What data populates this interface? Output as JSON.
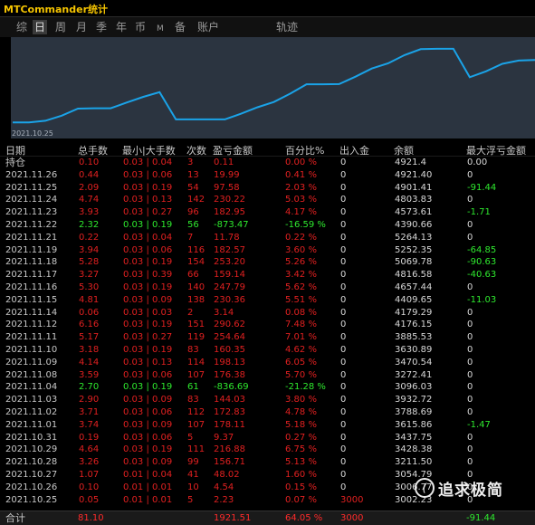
{
  "window": {
    "title": "MTCommander统计"
  },
  "tabs": [
    {
      "label": "综",
      "active": false
    },
    {
      "label": "日",
      "active": true
    },
    {
      "label": "周",
      "active": false
    },
    {
      "label": "月",
      "active": false
    },
    {
      "label": "季",
      "active": false
    },
    {
      "label": "年",
      "active": false
    },
    {
      "label": "币",
      "active": false
    },
    {
      "label": "M",
      "active": false
    },
    {
      "label": "备",
      "active": false
    },
    {
      "label": "账户",
      "active": false
    },
    {
      "label": "轨迹",
      "active": false
    }
  ],
  "chart": {
    "date_label": "2021.10.25",
    "line_color": "#1aa3e8",
    "background": "#2b3440"
  },
  "chart_data": {
    "type": "line",
    "x": [
      "2021.10.25",
      "2021.10.26",
      "2021.10.27",
      "2021.10.28",
      "2021.10.29",
      "2021.10.30",
      "2021.10.31",
      "2021.11.01",
      "2021.11.02",
      "2021.11.03",
      "2021.11.04",
      "2021.11.05",
      "2021.11.06",
      "2021.11.07",
      "2021.11.08",
      "2021.11.09",
      "2021.11.10",
      "2021.11.11",
      "2021.11.12",
      "2021.11.13",
      "2021.11.14",
      "2021.11.15",
      "2021.11.16",
      "2021.11.17",
      "2021.11.18",
      "2021.11.19",
      "2021.11.20",
      "2021.11.21",
      "2021.11.22",
      "2021.11.23",
      "2021.11.24",
      "2021.11.25",
      "2021.11.26"
    ],
    "values": [
      3002.23,
      3006.77,
      3054.79,
      3211.5,
      3428.38,
      3437.75,
      3437.75,
      3615.86,
      3788.69,
      3932.72,
      3096.03,
      3096.03,
      3096.03,
      3096.03,
      3272.41,
      3470.54,
      3630.89,
      3885.53,
      4176.15,
      4176.15,
      4179.29,
      4409.65,
      4657.44,
      4816.58,
      5069.78,
      5252.35,
      5264.13,
      5264.13,
      4390.66,
      4573.61,
      4803.83,
      4901.41,
      4921.4
    ],
    "ylim": [
      2900,
      5400
    ]
  },
  "table": {
    "headers": [
      "日期",
      "总手数",
      "最小|大手数",
      "次数",
      "盈亏金额",
      "百分比%",
      "出入金",
      "余额",
      "最大浮亏金额"
    ],
    "rows": [
      {
        "date": "持仓",
        "lots": "0.10",
        "range": "0.03 | 0.04",
        "count": "3",
        "pnl": "0.11",
        "pct": "0.00 %",
        "io": "0",
        "bal": "4921.4",
        "dd": "0.00",
        "color": "red",
        "ddcolor": "white"
      },
      {
        "date": "2021.11.26",
        "lots": "0.44",
        "range": "0.03 | 0.06",
        "count": "13",
        "pnl": "19.99",
        "pct": "0.41 %",
        "io": "0",
        "bal": "4921.40",
        "dd": "0",
        "color": "red",
        "ddcolor": "white"
      },
      {
        "date": "2021.11.25",
        "lots": "2.09",
        "range": "0.03 | 0.19",
        "count": "54",
        "pnl": "97.58",
        "pct": "2.03 %",
        "io": "0",
        "bal": "4901.41",
        "dd": "-91.44",
        "color": "red",
        "ddcolor": "green"
      },
      {
        "date": "2021.11.24",
        "lots": "4.74",
        "range": "0.03 | 0.13",
        "count": "142",
        "pnl": "230.22",
        "pct": "5.03 %",
        "io": "0",
        "bal": "4803.83",
        "dd": "0",
        "color": "red",
        "ddcolor": "white"
      },
      {
        "date": "2021.11.23",
        "lots": "3.93",
        "range": "0.03 | 0.27",
        "count": "96",
        "pnl": "182.95",
        "pct": "4.17 %",
        "io": "0",
        "bal": "4573.61",
        "dd": "-1.71",
        "color": "red",
        "ddcolor": "green"
      },
      {
        "date": "2021.11.22",
        "lots": "2.32",
        "range": "0.03 | 0.19",
        "count": "56",
        "pnl": "-873.47",
        "pct": "-16.59 %",
        "io": "0",
        "bal": "4390.66",
        "dd": "0",
        "color": "green",
        "ddcolor": "white"
      },
      {
        "date": "2021.11.21",
        "lots": "0.22",
        "range": "0.03 | 0.04",
        "count": "7",
        "pnl": "11.78",
        "pct": "0.22 %",
        "io": "0",
        "bal": "5264.13",
        "dd": "0",
        "color": "red",
        "ddcolor": "white"
      },
      {
        "date": "2021.11.19",
        "lots": "3.94",
        "range": "0.03 | 0.06",
        "count": "116",
        "pnl": "182.57",
        "pct": "3.60 %",
        "io": "0",
        "bal": "5252.35",
        "dd": "-64.85",
        "color": "red",
        "ddcolor": "green"
      },
      {
        "date": "2021.11.18",
        "lots": "5.28",
        "range": "0.03 | 0.19",
        "count": "154",
        "pnl": "253.20",
        "pct": "5.26 %",
        "io": "0",
        "bal": "5069.78",
        "dd": "-90.63",
        "color": "red",
        "ddcolor": "green"
      },
      {
        "date": "2021.11.17",
        "lots": "3.27",
        "range": "0.03 | 0.39",
        "count": "66",
        "pnl": "159.14",
        "pct": "3.42 %",
        "io": "0",
        "bal": "4816.58",
        "dd": "-40.63",
        "color": "red",
        "ddcolor": "green"
      },
      {
        "date": "2021.11.16",
        "lots": "5.30",
        "range": "0.03 | 0.19",
        "count": "140",
        "pnl": "247.79",
        "pct": "5.62 %",
        "io": "0",
        "bal": "4657.44",
        "dd": "0",
        "color": "red",
        "ddcolor": "white"
      },
      {
        "date": "2021.11.15",
        "lots": "4.81",
        "range": "0.03 | 0.09",
        "count": "138",
        "pnl": "230.36",
        "pct": "5.51 %",
        "io": "0",
        "bal": "4409.65",
        "dd": "-11.03",
        "color": "red",
        "ddcolor": "green"
      },
      {
        "date": "2021.11.14",
        "lots": "0.06",
        "range": "0.03 | 0.03",
        "count": "2",
        "pnl": "3.14",
        "pct": "0.08 %",
        "io": "0",
        "bal": "4179.29",
        "dd": "0",
        "color": "red",
        "ddcolor": "white"
      },
      {
        "date": "2021.11.12",
        "lots": "6.16",
        "range": "0.03 | 0.19",
        "count": "151",
        "pnl": "290.62",
        "pct": "7.48 %",
        "io": "0",
        "bal": "4176.15",
        "dd": "0",
        "color": "red",
        "ddcolor": "white"
      },
      {
        "date": "2021.11.11",
        "lots": "5.17",
        "range": "0.03 | 0.27",
        "count": "119",
        "pnl": "254.64",
        "pct": "7.01 %",
        "io": "0",
        "bal": "3885.53",
        "dd": "0",
        "color": "red",
        "ddcolor": "white"
      },
      {
        "date": "2021.11.10",
        "lots": "3.18",
        "range": "0.03 | 0.19",
        "count": "83",
        "pnl": "160.35",
        "pct": "4.62 %",
        "io": "0",
        "bal": "3630.89",
        "dd": "0",
        "color": "red",
        "ddcolor": "white"
      },
      {
        "date": "2021.11.09",
        "lots": "4.14",
        "range": "0.03 | 0.13",
        "count": "114",
        "pnl": "198.13",
        "pct": "6.05 %",
        "io": "0",
        "bal": "3470.54",
        "dd": "0",
        "color": "red",
        "ddcolor": "white"
      },
      {
        "date": "2021.11.08",
        "lots": "3.59",
        "range": "0.03 | 0.06",
        "count": "107",
        "pnl": "176.38",
        "pct": "5.70 %",
        "io": "0",
        "bal": "3272.41",
        "dd": "0",
        "color": "red",
        "ddcolor": "white"
      },
      {
        "date": "2021.11.04",
        "lots": "2.70",
        "range": "0.03 | 0.19",
        "count": "61",
        "pnl": "-836.69",
        "pct": "-21.28 %",
        "io": "0",
        "bal": "3096.03",
        "dd": "0",
        "color": "green",
        "ddcolor": "white"
      },
      {
        "date": "2021.11.03",
        "lots": "2.90",
        "range": "0.03 | 0.09",
        "count": "83",
        "pnl": "144.03",
        "pct": "3.80 %",
        "io": "0",
        "bal": "3932.72",
        "dd": "0",
        "color": "red",
        "ddcolor": "white"
      },
      {
        "date": "2021.11.02",
        "lots": "3.71",
        "range": "0.03 | 0.06",
        "count": "112",
        "pnl": "172.83",
        "pct": "4.78 %",
        "io": "0",
        "bal": "3788.69",
        "dd": "0",
        "color": "red",
        "ddcolor": "white"
      },
      {
        "date": "2021.11.01",
        "lots": "3.74",
        "range": "0.03 | 0.09",
        "count": "107",
        "pnl": "178.11",
        "pct": "5.18 %",
        "io": "0",
        "bal": "3615.86",
        "dd": "-1.47",
        "color": "red",
        "ddcolor": "green"
      },
      {
        "date": "2021.10.31",
        "lots": "0.19",
        "range": "0.03 | 0.06",
        "count": "5",
        "pnl": "9.37",
        "pct": "0.27 %",
        "io": "0",
        "bal": "3437.75",
        "dd": "0",
        "color": "red",
        "ddcolor": "white"
      },
      {
        "date": "2021.10.29",
        "lots": "4.64",
        "range": "0.03 | 0.19",
        "count": "111",
        "pnl": "216.88",
        "pct": "6.75 %",
        "io": "0",
        "bal": "3428.38",
        "dd": "0",
        "color": "red",
        "ddcolor": "white"
      },
      {
        "date": "2021.10.28",
        "lots": "3.26",
        "range": "0.03 | 0.09",
        "count": "99",
        "pnl": "156.71",
        "pct": "5.13 %",
        "io": "0",
        "bal": "3211.50",
        "dd": "0",
        "color": "red",
        "ddcolor": "white"
      },
      {
        "date": "2021.10.27",
        "lots": "1.07",
        "range": "0.01 | 0.04",
        "count": "41",
        "pnl": "48.02",
        "pct": "1.60 %",
        "io": "0",
        "bal": "3054.79",
        "dd": "0",
        "color": "red",
        "ddcolor": "white"
      },
      {
        "date": "2021.10.26",
        "lots": "0.10",
        "range": "0.01 | 0.01",
        "count": "10",
        "pnl": "4.54",
        "pct": "0.15 %",
        "io": "0",
        "bal": "3006.77",
        "dd": "0",
        "color": "red",
        "ddcolor": "white"
      },
      {
        "date": "2021.10.25",
        "lots": "0.05",
        "range": "0.01 | 0.01",
        "count": "5",
        "pnl": "2.23",
        "pct": "0.07 %",
        "io": "3000",
        "bal": "3002.23",
        "dd": "0",
        "color": "red",
        "ddcolor": "white"
      }
    ],
    "footer": {
      "label": "合计",
      "lots": "81.10",
      "pnl": "1921.51",
      "pct": "64.05 %",
      "io": "3000",
      "dd": "-91.44"
    }
  },
  "watermark": {
    "icon": "zhihu-icon",
    "glyph": "(",
    "text": "追求极简"
  }
}
